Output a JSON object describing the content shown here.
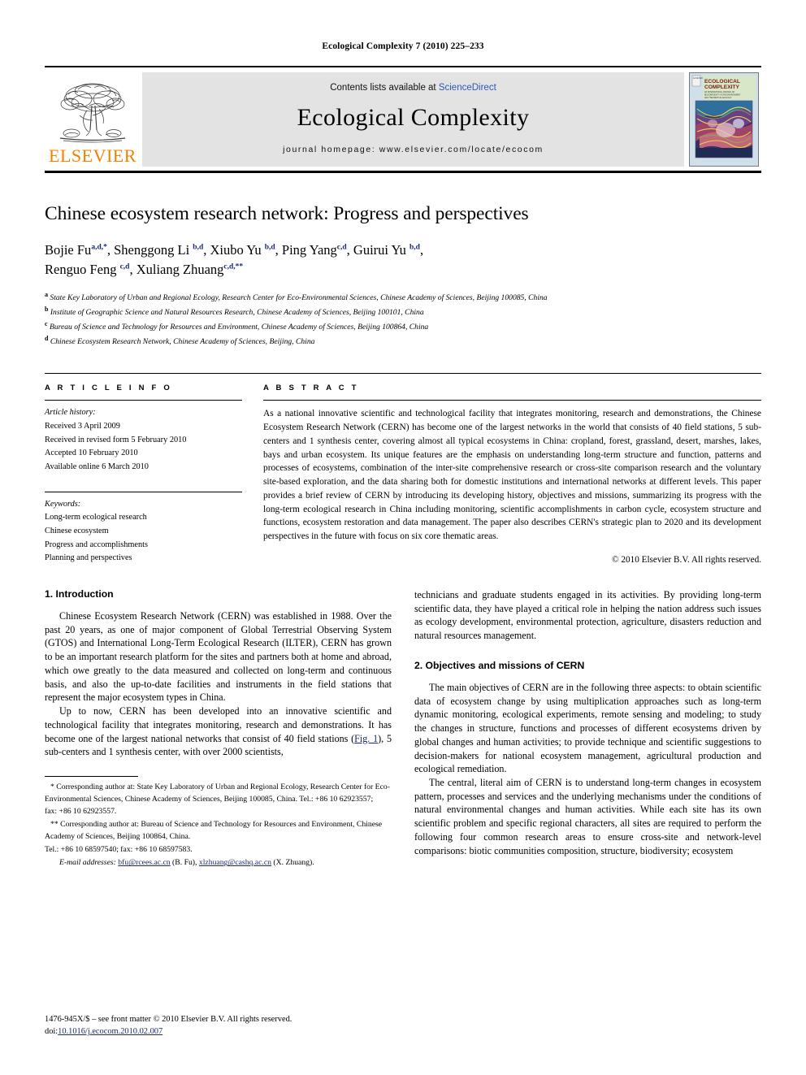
{
  "running_head": "Ecological Complexity 7 (2010) 225–233",
  "masthead": {
    "publisher_name": "ELSEVIER",
    "contents_text": "Contents lists available at",
    "sciencedirect_label": "ScienceDirect",
    "journal_title": "Ecological Complexity",
    "homepage_text": "journal homepage: www.elsevier.com/locate/ecocom",
    "cover": {
      "line1": "ECOLOGICAL",
      "line2": "COMPLEXITY",
      "subtitle": "AN INTERNATIONAL JOURNAL ON BIOCOMPLEXITY IN THE ENVIRONMENT AND THEORETICAL ECOLOGY"
    }
  },
  "article": {
    "title": "Chinese ecosystem research network: Progress and perspectives",
    "authors": [
      {
        "name": "Bojie Fu",
        "sup": "a,d,*"
      },
      {
        "name": "Shenggong Li",
        "sup": "b,d"
      },
      {
        "name": "Xiubo Yu",
        "sup": "b,d"
      },
      {
        "name": "Ping Yang",
        "sup": "c,d"
      },
      {
        "name": "Guirui Yu",
        "sup": "b,d"
      },
      {
        "name": "Renguo Feng",
        "sup": "c,d"
      },
      {
        "name": "Xuliang Zhuang",
        "sup": "c,d,**"
      }
    ],
    "affiliations": [
      {
        "mark": "a",
        "text": "State Key Laboratory of Urban and Regional Ecology, Research Center for Eco-Environmental Sciences, Chinese Academy of Sciences, Beijing 100085, China"
      },
      {
        "mark": "b",
        "text": "Institute of Geographic Science and Natural Resources Research, Chinese Academy of Sciences, Beijing 100101, China"
      },
      {
        "mark": "c",
        "text": "Bureau of Science and Technology for Resources and Environment, Chinese Academy of Sciences, Beijing 100864, China"
      },
      {
        "mark": "d",
        "text": "Chinese Ecosystem Research Network, Chinese Academy of Sciences, Beijing, China"
      }
    ]
  },
  "article_info": {
    "label": "A R T I C L E   I N F O",
    "history_heading": "Article history:",
    "history": [
      "Received 3 April 2009",
      "Received in revised form 5 February 2010",
      "Accepted 10 February 2010",
      "Available online 6 March 2010"
    ],
    "keywords_heading": "Keywords:",
    "keywords": [
      "Long-term ecological research",
      "Chinese ecosystem",
      "Progress and accomplishments",
      "Planning and perspectives"
    ]
  },
  "abstract": {
    "label": "A B S T R A C T",
    "text": "As a national innovative scientific and technological facility that integrates monitoring, research and demonstrations, the Chinese Ecosystem Research Network (CERN) has become one of the largest networks in the world that consists of 40 field stations, 5 sub-centers and 1 synthesis center, covering almost all typical ecosystems in China: cropland, forest, grassland, desert, marshes, lakes, bays and urban ecosystem. Its unique features are the emphasis on understanding long-term structure and function, patterns and processes of ecosystems, combination of the inter-site comprehensive research or cross-site comparison research and the voluntary site-based exploration, and the data sharing both for domestic institutions and international networks at different levels. This paper provides a brief review of CERN by introducing its developing history, objectives and missions, summarizing its progress with the long-term ecological research in China including monitoring, scientific accomplishments in carbon cycle, ecosystem structure and functions, ecosystem restoration and data management. The paper also describes CERN's strategic plan to 2020 and its development perspectives in the future with focus on six core thematic areas.",
    "copyright": "© 2010 Elsevier B.V. All rights reserved."
  },
  "sections": {
    "introduction_title": "1. Introduction",
    "intro_p1": "Chinese Ecosystem Research Network (CERN) was established in 1988. Over the past 20 years, as one of major component of Global Terrestrial Observing System (GTOS) and International Long-Term Ecological Research (ILTER), CERN has grown to be an important research platform for the sites and partners both at home and abroad, which owe greatly to the data measured and collected on long-term and continuous basis, and also the up-to-date facilities and instruments in the field stations that represent the major ecosystem types in China.",
    "intro_p2_a": "Up to now, CERN has been developed into an innovative scientific and technological facility that integrates monitoring, research and demonstrations. It has become one of the largest national networks that consist of 40 field stations (",
    "intro_p2_figref": "Fig. 1",
    "intro_p2_b": "), 5 sub-centers and 1 synthesis center, with over 2000 scientists,",
    "intro_p2_cont": "technicians and graduate students engaged in its activities. By providing long-term scientific data, they have played a critical role in helping the nation address such issues as ecology development, environmental protection, agriculture, disasters reduction and natural resources management.",
    "objectives_title": "2. Objectives and missions of CERN",
    "obj_p1": "The main objectives of CERN are in the following three aspects: to obtain scientific data of ecosystem change by using multiplication approaches such as long-term dynamic monitoring, ecological experiments, remote sensing and modeling; to study the changes in structure, functions and processes of different ecosystems driven by global changes and human activities; to provide technique and scientific suggestions to decision-makers for national ecosystem management, agricultural production and ecological remediation.",
    "obj_p2": "The central, literal aim of CERN is to understand long-term changes in ecosystem pattern, processes and services and the underlying mechanisms under the conditions of natural environmental changes and human activities. While each site has its own scientific problem and specific regional characters, all sites are required to perform the following four common research areas to ensure cross-site and network-level comparisons: biotic communities composition, structure, biodiversity; ecosystem"
  },
  "footnotes": {
    "fn1": "* Corresponding author at: State Key Laboratory of Urban and Regional Ecology, Research Center for Eco-Environmental Sciences, Chinese Academy of Sciences, Beijing 100085, China. Tel.: +86 10 62923557;",
    "fn1b": "fax: +86 10 62923557.",
    "fn2": "** Corresponding author at: Bureau of Science and Technology for Resources and Environment, Chinese Academy of Sciences, Beijing 100864, China.",
    "fn2b": "Tel.: +86 10 68597540; fax: +86 10 68597583.",
    "email_label": "E-mail addresses:",
    "email1": "bfu@rcees.ac.cn",
    "email1_owner": "(B. Fu),",
    "email2": "xlzhuang@cashq.ac.cn",
    "email2_owner": "(X. Zhuang)."
  },
  "footer": {
    "issn_line": "1476-945X/$ – see front matter © 2010 Elsevier B.V. All rights reserved.",
    "doi_prefix": "doi:",
    "doi": "10.1016/j.ecocom.2010.02.007"
  },
  "colors": {
    "elsevier_orange": "#F08100",
    "link_blue": "#2b58b5",
    "ref_blue": "#1a2a72",
    "masthead_grey": "#e3e3e3"
  }
}
